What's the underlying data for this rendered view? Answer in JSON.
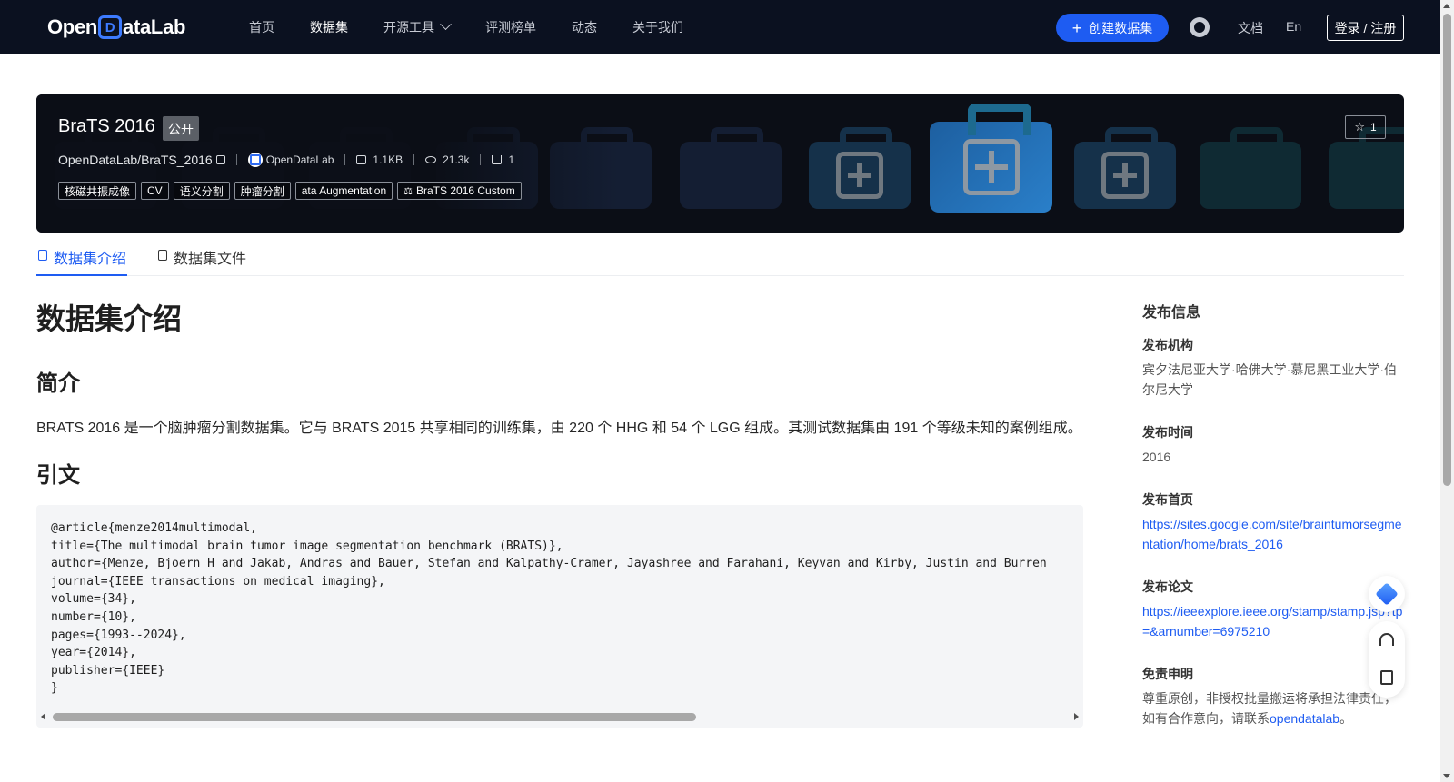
{
  "nav": {
    "logo": {
      "part1": "Open",
      "mark": "D",
      "part2": "ataLab"
    },
    "links": [
      {
        "label": "首页",
        "active": false
      },
      {
        "label": "数据集",
        "active": true
      },
      {
        "label": "开源工具",
        "active": false,
        "dropdown": true
      },
      {
        "label": "评测榜单",
        "active": false
      },
      {
        "label": "动态",
        "active": false
      },
      {
        "label": "关于我们",
        "active": false
      }
    ],
    "create_button": "创建数据集",
    "docs": "文档",
    "lang": "En",
    "login": "登录 / 注册"
  },
  "dataset": {
    "title": "BraTS 2016",
    "visibility": "公开",
    "repo": "OpenDataLab/BraTS_2016",
    "org": "OpenDataLab",
    "size": "1.1KB",
    "views": "21.3k",
    "downloads": "1",
    "tags": [
      "核磁共振成像",
      "CV",
      "语义分割",
      "肿瘤分割",
      "ata Augmentation"
    ],
    "license": "BraTS 2016 Custom",
    "stars": "1"
  },
  "tabs": {
    "intro": "数据集介绍",
    "files": "数据集文件"
  },
  "content": {
    "heading": "数据集介绍",
    "intro_heading": "简介",
    "intro_text": "BRATS 2016 是一个脑肿瘤分割数据集。它与 BRATS 2015 共享相同的训练集，由 220 个 HHG 和 54 个 LGG 组成。其测试数据集由 191 个等级未知的案例组成。",
    "cite_heading": "引文",
    "citation": "@article{menze2014multimodal,\ntitle={The multimodal brain tumor image segmentation benchmark (BRATS)},\nauthor={Menze, Bjoern H and Jakab, Andras and Bauer, Stefan and Kalpathy-Cramer, Jayashree and Farahani, Keyvan and Kirby, Justin and Burren\njournal={IEEE transactions on medical imaging},\nvolume={34},\nnumber={10},\npages={1993--2024},\nyear={2014},\npublisher={IEEE}\n}"
  },
  "sidebar": {
    "title": "发布信息",
    "org_label": "发布机构",
    "org_value": "宾夕法尼亚大学·哈佛大学·慕尼黑工业大学·伯尔尼大学",
    "time_label": "发布时间",
    "time_value": "2016",
    "home_label": "发布首页",
    "home_value": "https://sites.google.com/site/braintumorsegmentation/home/brats_2016",
    "paper_label": "发布论文",
    "paper_value": "https://ieeexplore.ieee.org/stamp/stamp.jsp?tp=&arnumber=6975210",
    "disclaimer_label": "免责申明",
    "disclaimer_text": "尊重原创，非授权批量搬运将承担法律责任，如有合作意向，请联系",
    "disclaimer_link": "opendatalab",
    "disclaimer_end": "。"
  }
}
